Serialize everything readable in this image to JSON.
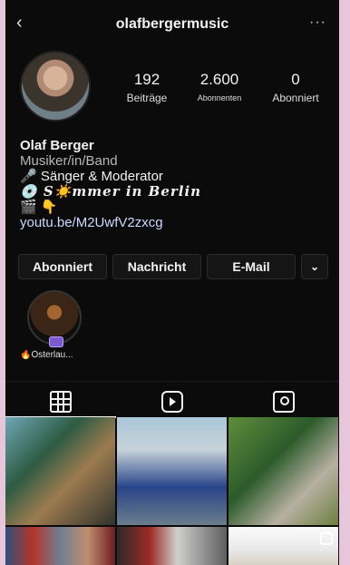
{
  "header": {
    "back_icon": "chevron-left-icon",
    "username": "olafbergermusic",
    "more_icon": "more-horizontal-icon"
  },
  "profile": {
    "avatar": "profile-photo",
    "stats": [
      {
        "value": "192",
        "label": "Beiträge"
      },
      {
        "value": "2.600",
        "label": "Abonnenten"
      },
      {
        "value": "0",
        "label": "Abonniert"
      }
    ]
  },
  "bio": {
    "name": "Olaf Berger",
    "category": "Musiker/in/Band",
    "line1": "🎤 Sänger & Moderator",
    "line2": "💿 S☀️mmer in Berlin",
    "line3": "🎬 👇",
    "link": "youtu.be/M2UwfV2zxcg"
  },
  "buttons": {
    "follow": "Abonniert",
    "message": "Nachricht",
    "email": "E-Mail",
    "dropdown_icon": "chevron-down-icon",
    "dropdown_glyph": "⌄"
  },
  "highlight": {
    "label": "🔥Österlau..."
  },
  "tabs": [
    {
      "name": "grid-icon"
    },
    {
      "name": "video-icon"
    },
    {
      "name": "tagged-icon"
    }
  ],
  "colors": {
    "background": "#0b0b0b",
    "frame": "#e7c6dc",
    "text": "#f2f2f2",
    "secondary_text": "#b8b8b8"
  }
}
